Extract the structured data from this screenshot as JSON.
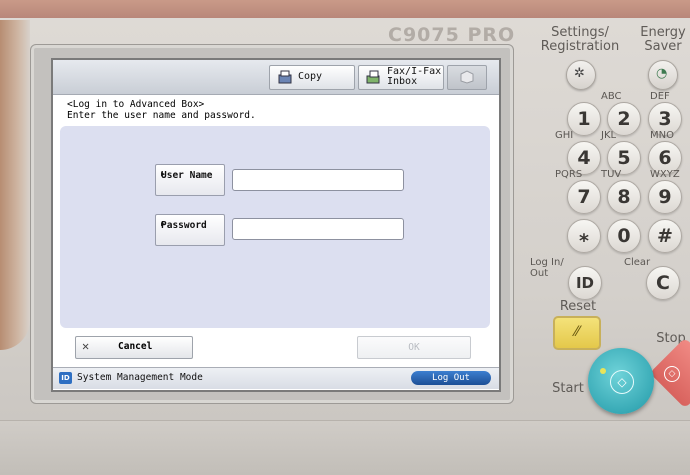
{
  "device": {
    "model": "C9075 PRO"
  },
  "screen": {
    "toolbar": {
      "copy": "Copy",
      "fax_line1": "Fax/I-Fax",
      "fax_line2": "Inbox"
    },
    "message_line1": "<Log in to Advanced Box>",
    "message_line2": "Enter the user name and password.",
    "form": {
      "user_name_label": "User Name",
      "user_name_value": "",
      "password_label": "Password",
      "password_value": ""
    },
    "cancel": "Cancel",
    "ok": "OK",
    "status": {
      "badge": "ID",
      "mode": "System Management Mode",
      "logout": "Log Out"
    }
  },
  "panel": {
    "settings_label_line1": "Settings/",
    "settings_label_line2": "Registration",
    "energy_label_line1": "Energy",
    "energy_label_line2": "Saver",
    "keys": [
      {
        "digit": "1",
        "letters": ""
      },
      {
        "digit": "2",
        "letters": "ABC"
      },
      {
        "digit": "3",
        "letters": "DEF"
      },
      {
        "digit": "4",
        "letters": "GHI"
      },
      {
        "digit": "5",
        "letters": "JKL"
      },
      {
        "digit": "6",
        "letters": "MNO"
      },
      {
        "digit": "7",
        "letters": "PQRS"
      },
      {
        "digit": "8",
        "letters": "TUV"
      },
      {
        "digit": "9",
        "letters": "WXYZ"
      },
      {
        "digit": "⁎",
        "letters": ""
      },
      {
        "digit": "0",
        "letters": ""
      },
      {
        "digit": "#",
        "letters": ""
      }
    ],
    "login_label_line1": "Log In/",
    "login_label_line2": "Out",
    "login_key": "ID",
    "clear_label": "Clear",
    "clear_key": "C",
    "reset_label": "Reset",
    "stop_label": "Stop",
    "start_label": "Start"
  },
  "colors": {
    "start": "#38aab6",
    "stop": "#d8625d",
    "reset": "#e4c84a",
    "logout": "#1d4f96"
  }
}
